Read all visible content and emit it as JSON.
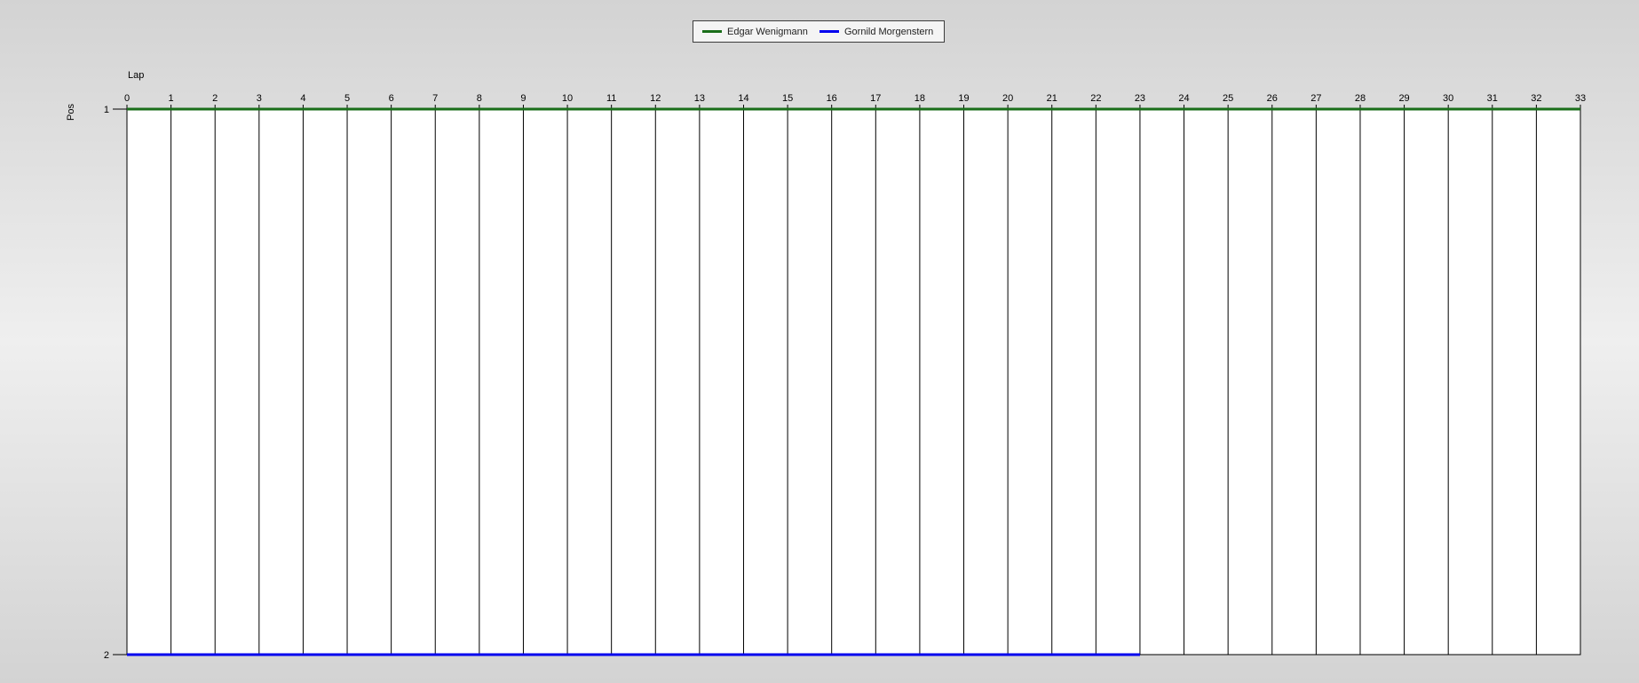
{
  "chart_data": {
    "type": "line",
    "xlabel": "Lap",
    "ylabel": "Pos",
    "xlim": [
      0,
      33
    ],
    "ylim": [
      1,
      2
    ],
    "x_ticks": [
      0,
      1,
      2,
      3,
      4,
      5,
      6,
      7,
      8,
      9,
      10,
      11,
      12,
      13,
      14,
      15,
      16,
      17,
      18,
      19,
      20,
      21,
      22,
      23,
      24,
      25,
      26,
      27,
      28,
      29,
      30,
      31,
      32,
      33
    ],
    "y_ticks": [
      1,
      2
    ],
    "y_inverted": true,
    "x_axis_position": "top",
    "grid": "vertical",
    "legend_position": "top-center",
    "series": [
      {
        "name": "Edgar Wenigmann",
        "color": "#1a6e1a",
        "x": [
          0,
          1,
          2,
          3,
          4,
          5,
          6,
          7,
          8,
          9,
          10,
          11,
          12,
          13,
          14,
          15,
          16,
          17,
          18,
          19,
          20,
          21,
          22,
          23,
          24,
          25,
          26,
          27,
          28,
          29,
          30,
          31,
          32,
          33
        ],
        "values": [
          1,
          1,
          1,
          1,
          1,
          1,
          1,
          1,
          1,
          1,
          1,
          1,
          1,
          1,
          1,
          1,
          1,
          1,
          1,
          1,
          1,
          1,
          1,
          1,
          1,
          1,
          1,
          1,
          1,
          1,
          1,
          1,
          1,
          1
        ]
      },
      {
        "name": "Gornild Morgenstern",
        "color": "#0000ee",
        "x": [
          0,
          1,
          2,
          3,
          4,
          5,
          6,
          7,
          8,
          9,
          10,
          11,
          12,
          13,
          14,
          15,
          16,
          17,
          18,
          19,
          20,
          21,
          22,
          23
        ],
        "values": [
          2,
          2,
          2,
          2,
          2,
          2,
          2,
          2,
          2,
          2,
          2,
          2,
          2,
          2,
          2,
          2,
          2,
          2,
          2,
          2,
          2,
          2,
          2,
          2
        ]
      }
    ]
  }
}
